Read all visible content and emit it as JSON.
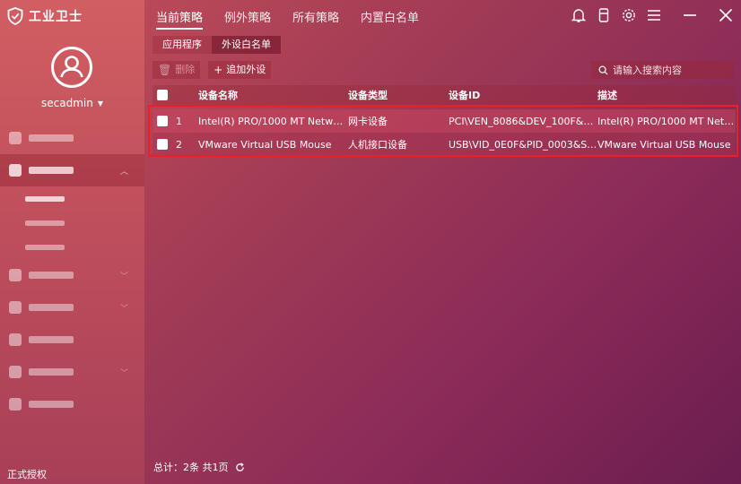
{
  "app": {
    "name": "工业卫士"
  },
  "user": {
    "name": "secadmin"
  },
  "sidebar": {
    "license": "正式授权",
    "items": [
      {
        "icon": "home-icon",
        "expandable": false,
        "active": false
      },
      {
        "icon": "policy-icon",
        "expandable": true,
        "active": true,
        "sub": [
          {
            "active": true
          },
          {
            "active": false
          },
          {
            "active": false
          }
        ]
      },
      {
        "icon": "shield-icon",
        "expandable": true,
        "active": false
      },
      {
        "icon": "host-icon",
        "expandable": true,
        "active": false
      },
      {
        "icon": "upgrade-icon",
        "expandable": false,
        "active": false
      },
      {
        "icon": "log-icon",
        "expandable": true,
        "active": false
      },
      {
        "icon": "account-icon",
        "expandable": false,
        "active": false
      }
    ]
  },
  "tabs": [
    "当前策略",
    "例外策略",
    "所有策略",
    "内置白名单"
  ],
  "active_tab": 0,
  "subtabs": [
    "应用程序",
    "外设白名单"
  ],
  "active_subtab": 1,
  "toolbar": {
    "delete_label": "删除",
    "add_label": "追加外设"
  },
  "search": {
    "placeholder": "请输入搜索内容"
  },
  "table": {
    "columns": {
      "name": "设备名称",
      "type": "设备类型",
      "id": "设备ID",
      "desc": "描述"
    },
    "rows": [
      {
        "index": "1",
        "name": "Intel(R) PRO/1000 MT Network…",
        "type": "网卡设备",
        "id": "PCI\\VEN_8086&DEV_100F&SU…",
        "desc": "Intel(R) PRO/1000 MT Network…"
      },
      {
        "index": "2",
        "name": "VMware Virtual USB Mouse",
        "type": "人机接口设备",
        "id": "USB\\VID_0E0F&PID_0003&SID…",
        "desc": "VMware Virtual USB Mouse"
      }
    ]
  },
  "footer": {
    "summary": "总计：2条 共1页"
  },
  "colors": {
    "highlight_border": "#e8202a",
    "sidebar_top": "#d15e62",
    "bg_bottom_right": "#6a1d4f"
  }
}
